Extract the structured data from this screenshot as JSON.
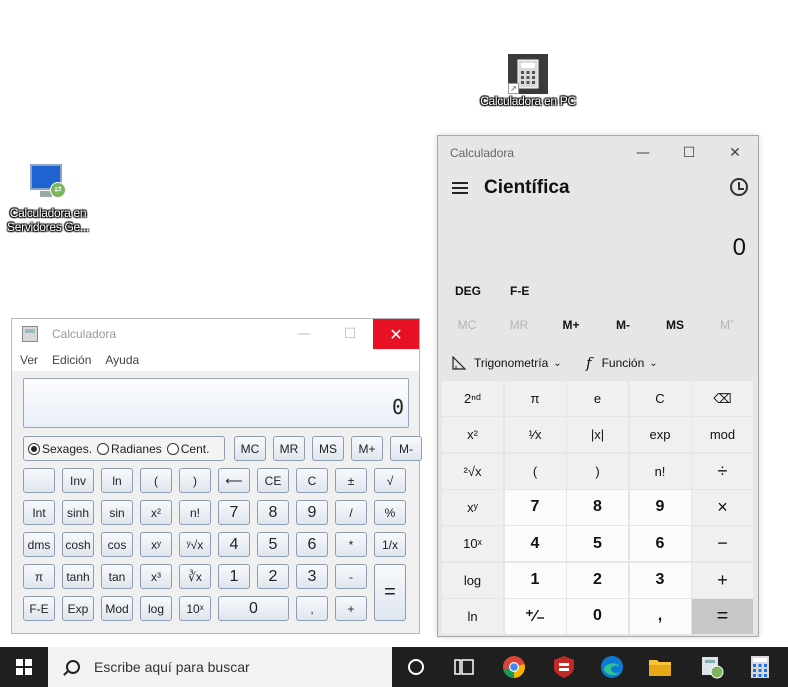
{
  "desktop_icons": [
    {
      "label": "Calculadora en PC",
      "icon": "calculator-shortcut-icon"
    },
    {
      "label": "Calculadora en Servidores Ge...",
      "icon": "remote-desktop-icon"
    }
  ],
  "classic_calc": {
    "title": "Calculadora",
    "menu": [
      "Ver",
      "Edición",
      "Ayuda"
    ],
    "display": "0",
    "angle_modes": [
      "Sexages.",
      "Radianes",
      "Cent."
    ],
    "selected_mode": "Sexages.",
    "memory": [
      "MC",
      "MR",
      "MS",
      "M+",
      "M-"
    ],
    "rows": [
      [
        "",
        "Inv",
        "ln",
        "(",
        ")",
        "⟵",
        "CE",
        "C",
        "±",
        "√"
      ],
      [
        "Int",
        "sinh",
        "sin",
        "x²",
        "n!",
        "7",
        "8",
        "9",
        "/",
        "%"
      ],
      [
        "dms",
        "cosh",
        "cos",
        "xʸ",
        "ʸ√x",
        "4",
        "5",
        "6",
        "*",
        "1/x"
      ],
      [
        "π",
        "tanh",
        "tan",
        "x³",
        "∛x",
        "1",
        "2",
        "3",
        "-",
        "="
      ],
      [
        "F-E",
        "Exp",
        "Mod",
        "log",
        "10ˣ",
        "0",
        ",",
        "+"
      ]
    ]
  },
  "modern_calc": {
    "title": "Calculadora",
    "mode": "Científica",
    "display": "0",
    "angle": "DEG",
    "fe": "F-E",
    "memory": [
      "MC",
      "MR",
      "M+",
      "M-",
      "MS",
      "Mˇ"
    ],
    "memory_enabled": [
      false,
      false,
      true,
      true,
      true,
      false
    ],
    "trig_label": "Trigonometría",
    "func_label": "Función",
    "keys": [
      [
        "2ⁿᵈ",
        "π",
        "e",
        "C",
        "⌫"
      ],
      [
        "x²",
        "¹⁄x",
        "|x|",
        "exp",
        "mod"
      ],
      [
        "²√x",
        "(",
        ")",
        "n!",
        "÷"
      ],
      [
        "xʸ",
        "7",
        "8",
        "9",
        "×"
      ],
      [
        "10ˣ",
        "4",
        "5",
        "6",
        "−"
      ],
      [
        "log",
        "1",
        "2",
        "3",
        "+"
      ],
      [
        "ln",
        "⁺⁄₋",
        "0",
        ",",
        "="
      ]
    ]
  },
  "taskbar": {
    "search_placeholder": "Escribe aquí para buscar",
    "pinned": [
      "cortana-icon",
      "task-view-icon",
      "chrome-icon",
      "antivirus-icon",
      "edge-icon",
      "file-explorer-icon",
      "remote-app-icon",
      "calculator-icon"
    ]
  }
}
